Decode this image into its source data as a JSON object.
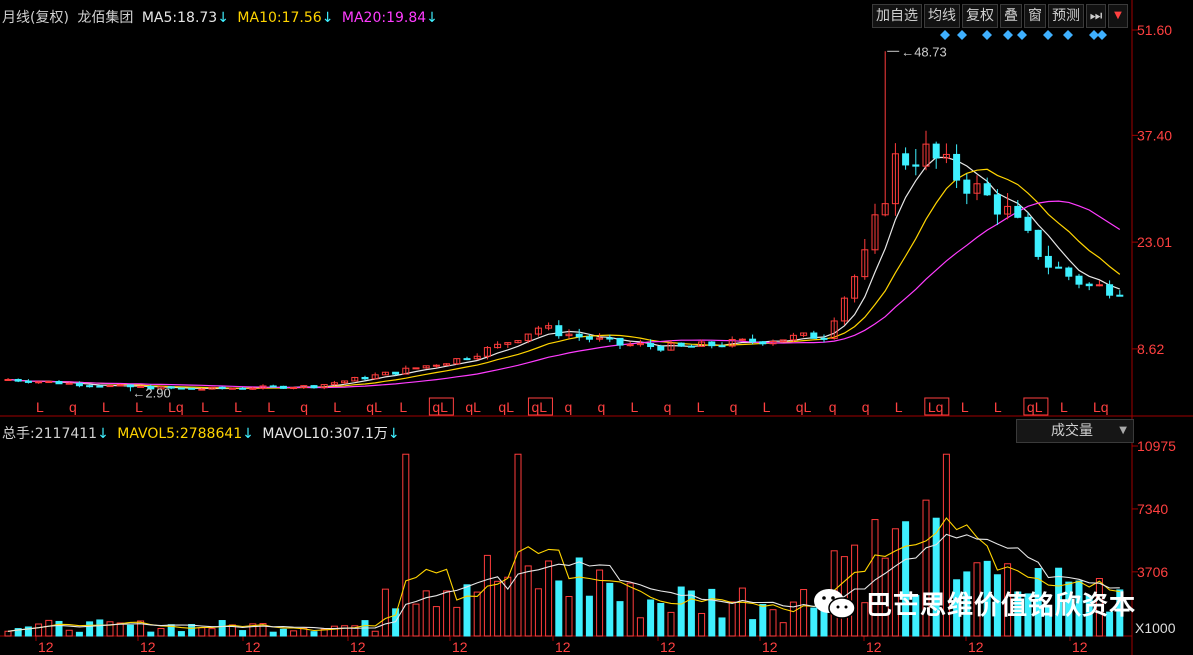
{
  "header": {
    "period": "月线(复权)",
    "stock_name": "龙佰集团",
    "ma5_label": "MA5:",
    "ma5_value": "18.73",
    "ma10_label": "MA10:",
    "ma10_value": "17.56",
    "ma20_label": "MA20:",
    "ma20_value": "19.84",
    "arrow_down": "↓"
  },
  "toolbar": {
    "items": [
      "加自选",
      "均线",
      "复权",
      "叠",
      "窗",
      "预测"
    ],
    "next_icon": "⏭",
    "dropdown_icon": "▼"
  },
  "price_axis": {
    "ticks": [
      "51.60",
      "37.40",
      "23.01",
      "8.62"
    ]
  },
  "annotations": {
    "high": "48.73",
    "low": "2.90"
  },
  "signals": [
    "L",
    "q",
    "L",
    "L",
    "Lq",
    "L",
    "L",
    "L",
    "q",
    "L",
    "qL",
    "L",
    "qL",
    "qL",
    "qL",
    "qL",
    "q",
    "q",
    "L",
    "q",
    "L",
    "q",
    "L",
    "qL",
    "q",
    "q",
    "L",
    "Lq",
    "L",
    "L",
    "qL",
    "L",
    "Lq"
  ],
  "volume_header": {
    "total_label": "总手:",
    "total_value": "2117411",
    "mavol5_label": "MAVOL5:",
    "mavol5_value": "2788641",
    "mavol10_label": "MAVOL10:",
    "mavol10_value": "307.1万",
    "arrow_down": "↓"
  },
  "volume_select": {
    "label": "成交量",
    "arrow": "▼"
  },
  "volume_axis": {
    "ticks": [
      "10975",
      "7340",
      "3706"
    ],
    "unit": "X1000"
  },
  "time_axis": {
    "labels": [
      "12",
      "12",
      "12",
      "12",
      "12",
      "12",
      "12",
      "12",
      "12",
      "12",
      "12"
    ]
  },
  "watermark": {
    "text": "巴芒思维价值铭欣资本"
  },
  "colors": {
    "up": "#ff3c3c",
    "down": "#3ff0ff",
    "ma5": "#e6e6e6",
    "ma10": "#ffd400",
    "ma20": "#ff3cff",
    "axis": "#a00000",
    "text_label": "#ff4040"
  },
  "chart_data": {
    "type": "candlestick",
    "price_axis_ticks": [
      51.6,
      37.4,
      23.01,
      8.62
    ],
    "price_high_marked": 48.73,
    "price_low_marked": 2.9,
    "ma_last": {
      "MA5": 18.73,
      "MA10": 17.56,
      "MA20": 19.84
    },
    "volume_axis_ticks": [
      10975,
      7340,
      3706
    ],
    "volume_unit": "X1000",
    "volume_last": 2117411,
    "mavol5_last": 2788641,
    "mavol10_last": "307.1万"
  }
}
